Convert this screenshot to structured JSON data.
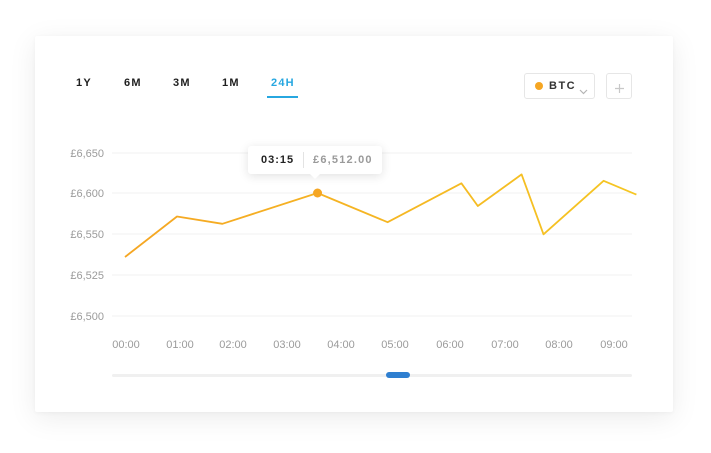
{
  "ranges": [
    "1Y",
    "6M",
    "3M",
    "1M",
    "24H"
  ],
  "active_range": "24H",
  "asset": {
    "symbol": "BTC",
    "color": "#f5a623"
  },
  "icons": {
    "dropdown": "chevron-down-icon",
    "add": "plus-icon"
  },
  "colors": {
    "accent": "#27a7e0",
    "line_start": "#f5a623",
    "line_end": "#f5c623"
  },
  "tooltip": {
    "time": "03:15",
    "value": "£6,512.00"
  },
  "chart_data": {
    "type": "line",
    "title": "",
    "xlabel": "",
    "ylabel": "",
    "y_ticks": [
      "£6,650",
      "£6,600",
      "£6,550",
      "£6,525",
      "£6,500"
    ],
    "x_ticks": [
      "00:00",
      "01:00",
      "02:00",
      "03:00",
      "04:00",
      "05:00",
      "06:00",
      "07:00",
      "08:00",
      "09:00"
    ],
    "grid": true,
    "series": [
      {
        "points": [
          {
            "t": 0.0,
            "v": 6521
          },
          {
            "t": 0.95,
            "v": 6571
          },
          {
            "t": 1.78,
            "v": 6562
          },
          {
            "t": 3.52,
            "v": 6600
          },
          {
            "t": 4.8,
            "v": 6564
          },
          {
            "t": 6.15,
            "v": 6612
          },
          {
            "t": 6.45,
            "v": 6584
          },
          {
            "t": 7.25,
            "v": 6623
          },
          {
            "t": 7.65,
            "v": 6549
          },
          {
            "t": 8.75,
            "v": 6615
          },
          {
            "t": 9.35,
            "v": 6598
          }
        ]
      }
    ],
    "highlight": {
      "t": 3.52,
      "v": 6600
    }
  }
}
